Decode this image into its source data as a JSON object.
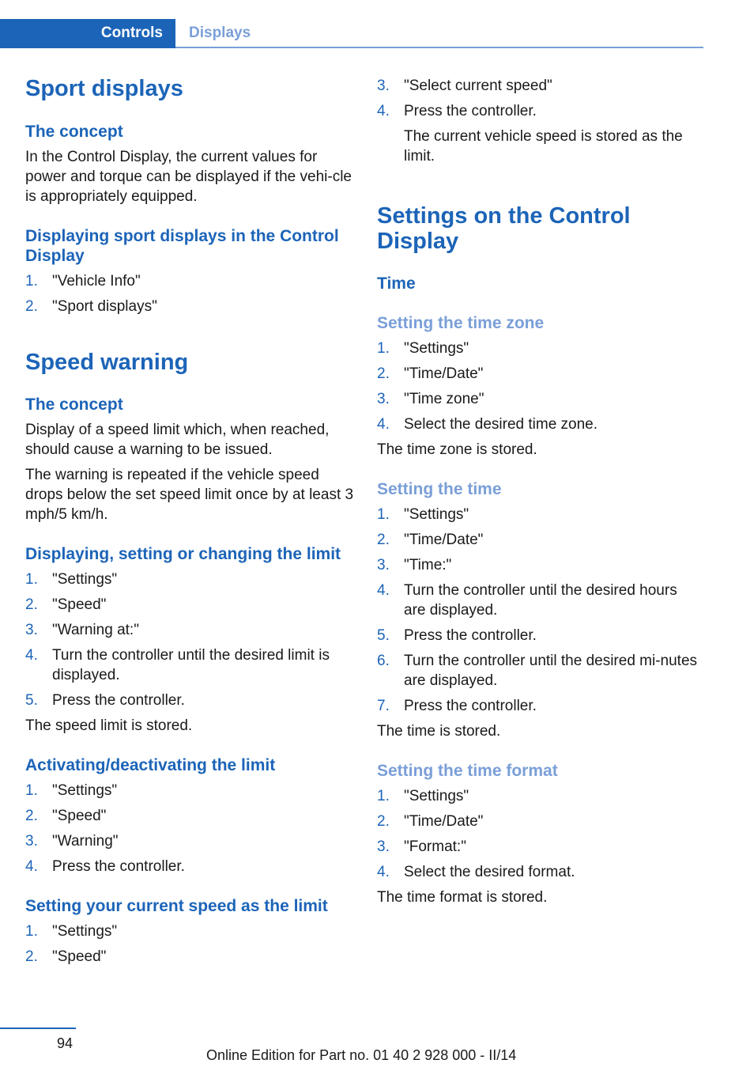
{
  "header": {
    "section": "Controls",
    "subsection": "Displays"
  },
  "left": {
    "sport": {
      "title": "Sport displays",
      "concept_heading": "The concept",
      "concept_text": "In the Control Display, the current values for power and torque can be displayed if the vehi-cle is appropriately equipped.",
      "display_heading": "Displaying sport displays in the Control Display",
      "display_steps": [
        "\"Vehicle Info\"",
        "\"Sport displays\""
      ]
    },
    "speed": {
      "title": "Speed warning",
      "concept_heading": "The concept",
      "concept_p1": "Display of a speed limit which, when reached, should cause a warning to be issued.",
      "concept_p2": "The warning is repeated if the vehicle speed drops below the set speed limit once by at least 3 mph/5 km/h.",
      "set_heading": "Displaying, setting or changing the limit",
      "set_steps": [
        "\"Settings\"",
        "\"Speed\"",
        "\"Warning at:\"",
        "Turn the controller until the desired limit is displayed.",
        "Press the controller."
      ],
      "set_result": "The speed limit is stored.",
      "activate_heading": "Activating/deactivating the limit",
      "activate_steps": [
        "\"Settings\"",
        "\"Speed\"",
        "\"Warning\"",
        "Press the controller."
      ],
      "current_heading": "Setting your current speed as the limit",
      "current_steps_left": [
        "\"Settings\"",
        "\"Speed\""
      ]
    }
  },
  "right": {
    "current_steps_right": [
      "\"Select current speed\"",
      "Press the controller."
    ],
    "current_result": "The current vehicle speed is stored as the limit.",
    "settings_title": "Settings on the Control Display",
    "time_heading": "Time",
    "zone": {
      "heading": "Setting the time zone",
      "steps": [
        "\"Settings\"",
        "\"Time/Date\"",
        "\"Time zone\"",
        "Select the desired time zone."
      ],
      "result": "The time zone is stored."
    },
    "time": {
      "heading": "Setting the time",
      "steps": [
        "\"Settings\"",
        "\"Time/Date\"",
        "\"Time:\"",
        "Turn the controller until the desired hours are displayed.",
        "Press the controller.",
        "Turn the controller until the desired mi-nutes are displayed.",
        "Press the controller."
      ],
      "result": "The time is stored."
    },
    "format": {
      "heading": "Setting the time format",
      "steps": [
        "\"Settings\"",
        "\"Time/Date\"",
        "\"Format:\"",
        "Select the desired format."
      ],
      "result": "The time format is stored."
    }
  },
  "footer": {
    "page_number": "94",
    "edition": "Online Edition for Part no. 01 40 2 928 000 - II/14"
  }
}
